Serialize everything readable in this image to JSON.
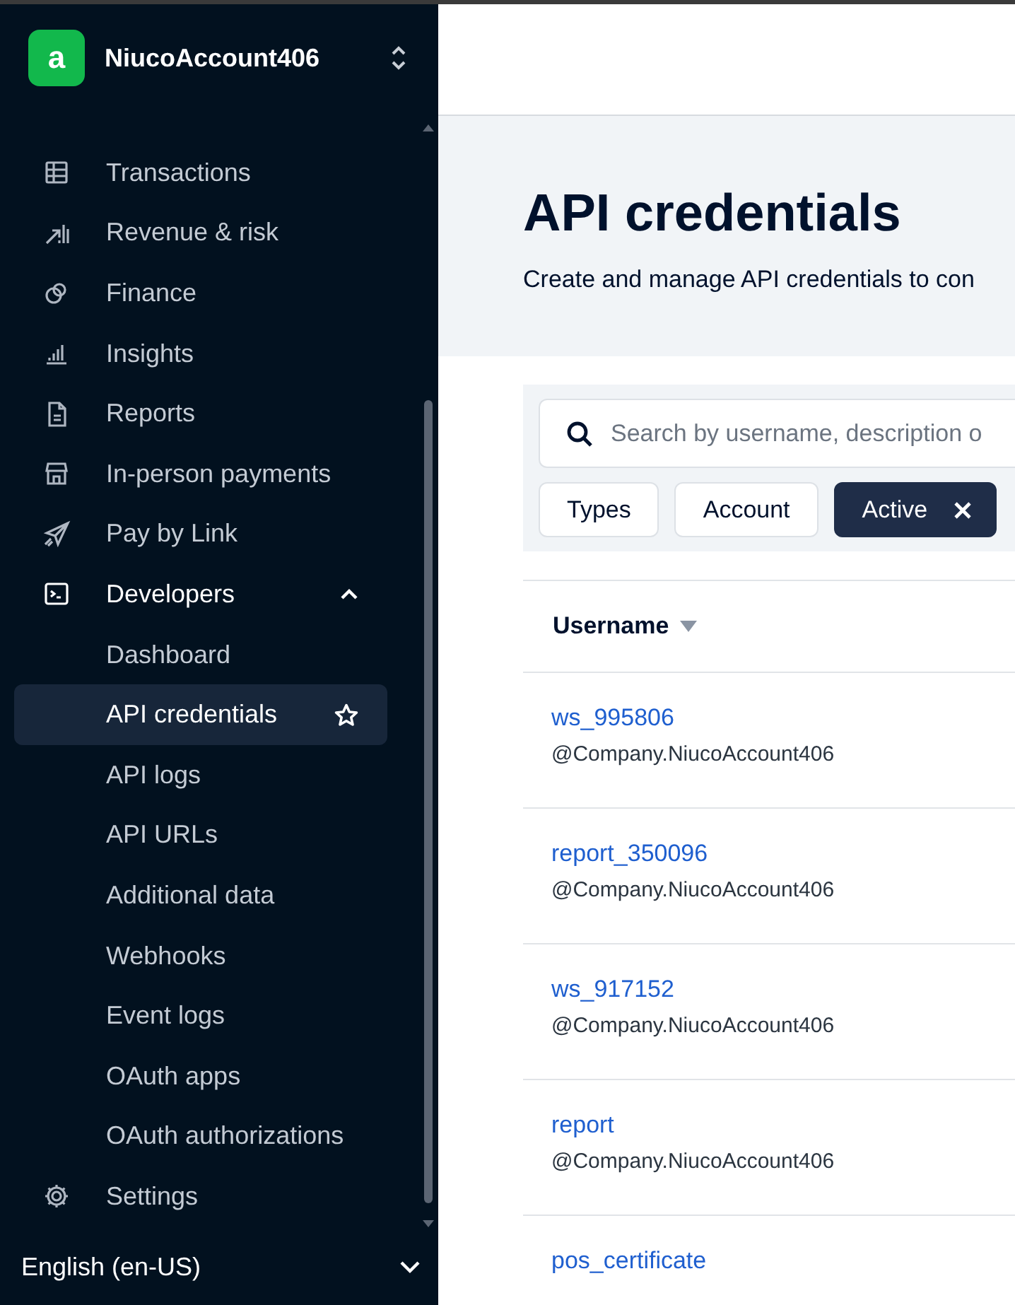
{
  "account": {
    "logo_letter": "a",
    "name": "NiucoAccount406"
  },
  "nav": [
    {
      "label": "Transactions",
      "selected": false
    },
    {
      "label": "Revenue & risk",
      "selected": false
    },
    {
      "label": "Finance",
      "selected": false
    },
    {
      "label": "Insights",
      "selected": false
    },
    {
      "label": "Reports",
      "selected": false
    },
    {
      "label": "In-person payments",
      "selected": false
    },
    {
      "label": "Pay by Link",
      "selected": false
    },
    {
      "label": "Developers",
      "selected": false,
      "expanded": true,
      "children": [
        {
          "label": "Dashboard",
          "selected": false
        },
        {
          "label": "API credentials",
          "selected": true
        },
        {
          "label": "API logs",
          "selected": false
        },
        {
          "label": "API URLs",
          "selected": false
        },
        {
          "label": "Additional data",
          "selected": false
        },
        {
          "label": "Webhooks",
          "selected": false
        },
        {
          "label": "Event logs",
          "selected": false
        },
        {
          "label": "OAuth apps",
          "selected": false
        },
        {
          "label": "OAuth authorizations",
          "selected": false
        }
      ]
    },
    {
      "label": "Settings",
      "selected": false
    }
  ],
  "language": "English (en-US)",
  "page": {
    "title": "API credentials",
    "subtitle": "Create and manage API credentials to con"
  },
  "search": {
    "placeholder": "Search by username, description o"
  },
  "filters": [
    {
      "label": "Types",
      "selected": false
    },
    {
      "label": "Account",
      "selected": false
    },
    {
      "label": "Active",
      "selected": true
    }
  ],
  "table": {
    "columns": [
      {
        "label": "Username"
      }
    ],
    "rows": [
      {
        "username": "ws_995806",
        "account": "@Company.NiucoAccount406"
      },
      {
        "username": "report_350096",
        "account": "@Company.NiucoAccount406"
      },
      {
        "username": "ws_917152",
        "account": "@Company.NiucoAccount406"
      },
      {
        "username": "report",
        "account": "@Company.NiucoAccount406"
      },
      {
        "username": "pos_certificate"
      }
    ]
  }
}
